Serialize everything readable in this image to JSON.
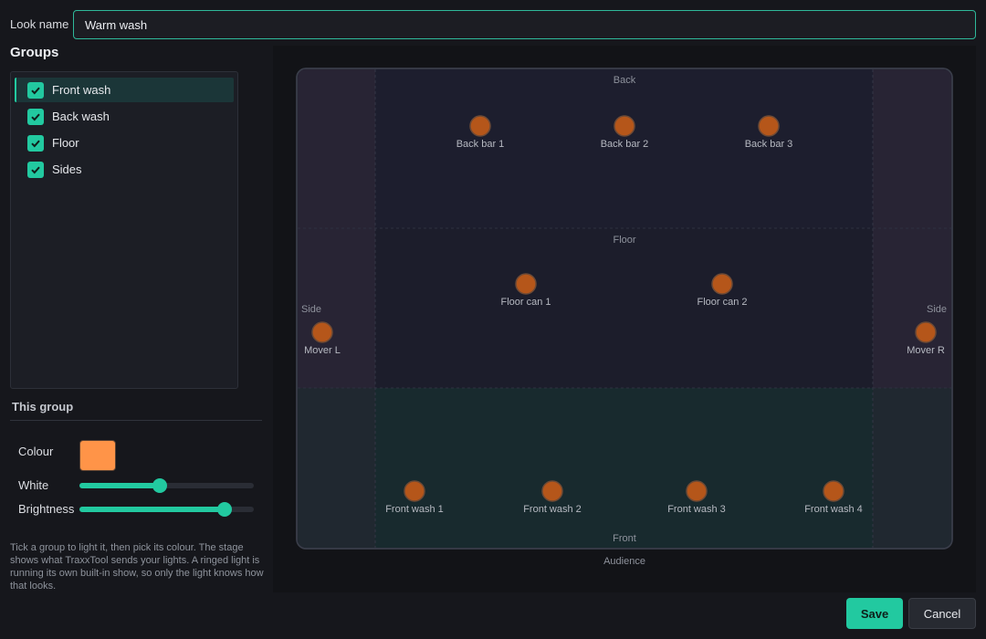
{
  "look": {
    "label": "Look name",
    "value": "Warm wash"
  },
  "groups": {
    "title": "Groups",
    "items": [
      {
        "label": "Front wash",
        "checked": true,
        "selected": true
      },
      {
        "label": "Back wash",
        "checked": true,
        "selected": false
      },
      {
        "label": "Floor",
        "checked": true,
        "selected": false
      },
      {
        "label": "Sides",
        "checked": true,
        "selected": false
      }
    ]
  },
  "this_group": {
    "title": "This group",
    "colour_label": "Colour",
    "colour_value": "#ff9448",
    "white_label": "White",
    "white_value": 0.46,
    "brightness_label": "Brightness",
    "brightness_value": 0.83
  },
  "help_text": "Tick a group to light it, then pick its colour. The stage shows what TraxxTool sends your lights. A ringed light is running its own built-in show, so only the light knows how that looks.",
  "stage": {
    "zones": {
      "back": "Back",
      "floor": "Floor",
      "side_left": "Side",
      "side_right": "Side",
      "front": "Front",
      "audience": "Audience"
    },
    "fixtures": {
      "back_bar_1": "Back bar 1",
      "back_bar_2": "Back bar 2",
      "back_bar_3": "Back bar 3",
      "floor_can_1": "Floor can 1",
      "floor_can_2": "Floor can 2",
      "mover_l": "Mover L",
      "mover_r": "Mover R",
      "front_wash_1": "Front wash 1",
      "front_wash_2": "Front wash 2",
      "front_wash_3": "Front wash 3",
      "front_wash_4": "Front wash 4"
    },
    "fixture_color": "#b5561a",
    "accent": "#22c9a0"
  },
  "buttons": {
    "save": "Save",
    "cancel": "Cancel"
  }
}
